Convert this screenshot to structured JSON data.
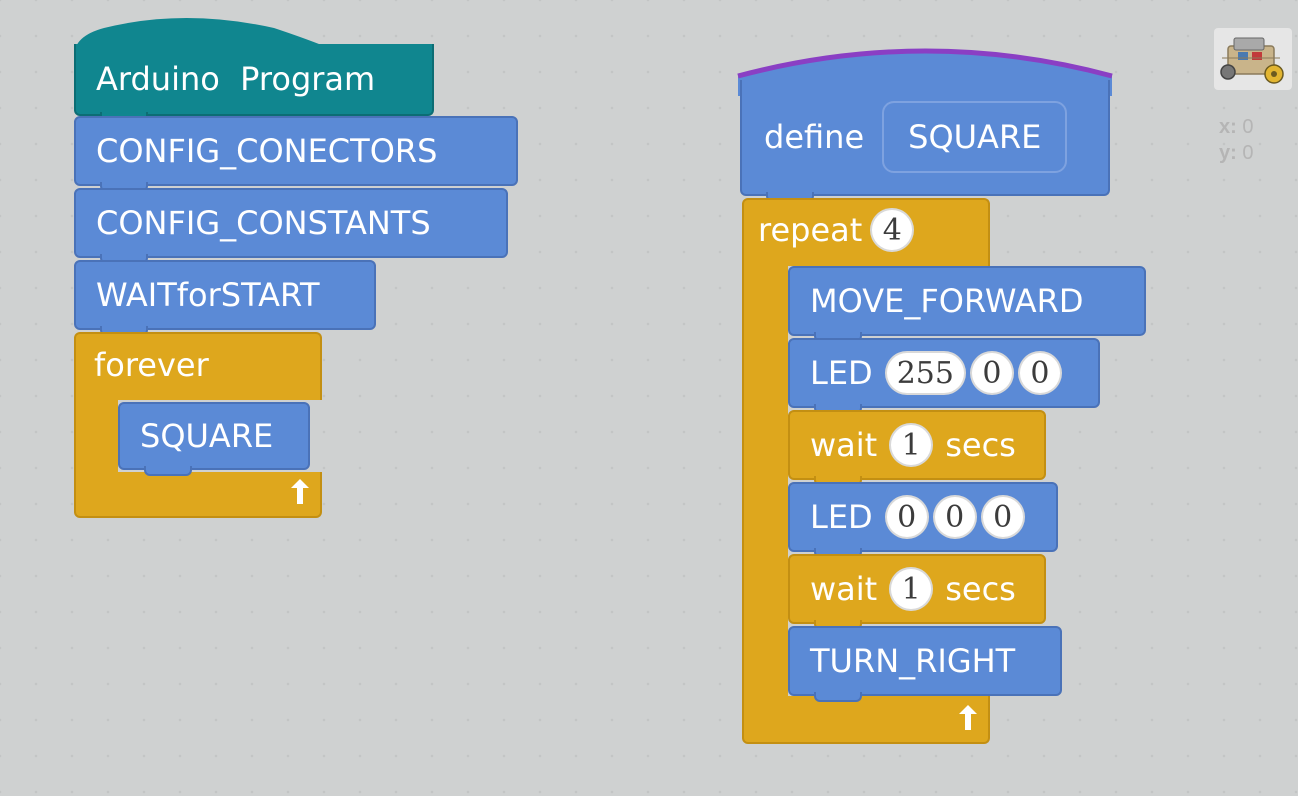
{
  "program": {
    "hat_label": "Arduino  Program",
    "blocks": [
      "CONFIG_CONECTORS",
      "CONFIG_CONSTANTS",
      "WAITforSTART"
    ],
    "forever_label": "forever",
    "call_label": "SQUARE",
    "loop_arrow": "⮥"
  },
  "define": {
    "label": "define",
    "name": "SQUARE",
    "repeat_label": "repeat",
    "repeat_count": "4",
    "move_forward": "MOVE_FORWARD",
    "led1": {
      "label": "LED",
      "r": "255",
      "g": "0",
      "b": "0"
    },
    "wait1": {
      "label": "wait",
      "value": "1",
      "unit": "secs"
    },
    "led2": {
      "label": "LED",
      "r": "0",
      "g": "0",
      "b": "0"
    },
    "wait2": {
      "label": "wait",
      "value": "1",
      "unit": "secs"
    },
    "turn_right": "TURN_RIGHT",
    "loop_arrow": "⮥"
  },
  "sprite": {
    "icon": "robot-car-icon",
    "x_label": "x:",
    "x_value": "0",
    "y_label": "y:",
    "y_value": "0"
  },
  "colors": {
    "motion_blue": "#5b8ad6",
    "control_gold": "#dea71d",
    "hat_teal": "#10868f",
    "define_arc": "#8a3fc4",
    "canvas": "#dcdddd"
  }
}
